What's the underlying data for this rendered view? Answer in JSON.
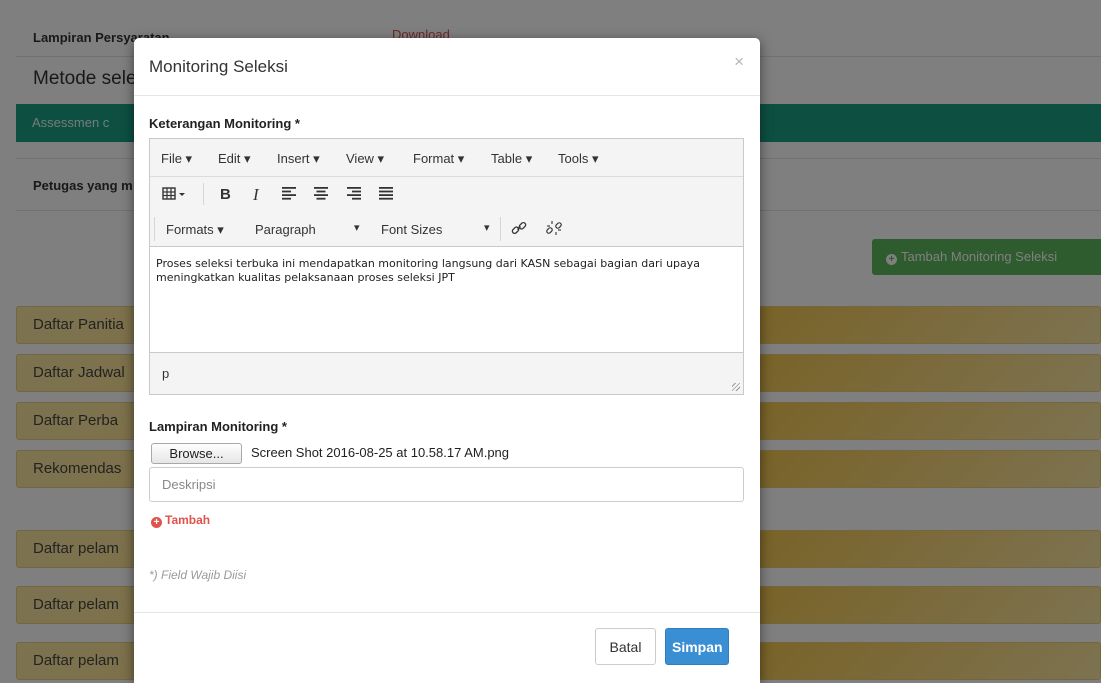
{
  "background": {
    "lampiran_label": "Lampiran Persyaratan",
    "download_link": "Download",
    "metode_heading": "Metode seleksi",
    "green_bar_text": "Assessmen c",
    "petugas_label": "Petugas yang m",
    "tambah_monitoring_button": "Tambah Monitoring Seleksi",
    "panels": [
      "Daftar Panitia",
      "Daftar Jadwal",
      "Daftar Perba",
      "Rekomendas",
      "Daftar pelam",
      "Daftar pelam",
      "Daftar pelam"
    ]
  },
  "modal": {
    "title": "Monitoring Seleksi",
    "close": "×",
    "keterangan_label": "Keterangan Monitoring *",
    "editor": {
      "menu": [
        "File ▾",
        "Edit ▾",
        "Insert ▾",
        "View ▾",
        "Format ▾",
        "Table ▾",
        "Tools ▾"
      ],
      "formats": "Formats ▾",
      "paragraph": "Paragraph",
      "font_sizes": "Font Sizes",
      "content": "Proses seleksi terbuka ini mendapatkan monitoring langsung dari KASN sebagai bagian dari upaya meningkatkan kualitas pelaksanaan proses seleksi JPT",
      "status_path": "p"
    },
    "lampiran_label": "Lampiran Monitoring *",
    "browse_button": "Browse...",
    "file_name": "Screen Shot 2016-08-25 at 10.58.17 AM.png",
    "deskripsi_placeholder": "Deskripsi",
    "tambah_link": "Tambah",
    "required_note": "*) Field Wajib Diisi",
    "batal_button": "Batal",
    "simpan_button": "Simpan"
  },
  "colors": {
    "green_bar": "#1aa085",
    "green_button": "#5cb85c",
    "primary_button": "#3a8fd4",
    "danger_link": "#e0524c",
    "panel_yellow": "#f8dc7b"
  }
}
